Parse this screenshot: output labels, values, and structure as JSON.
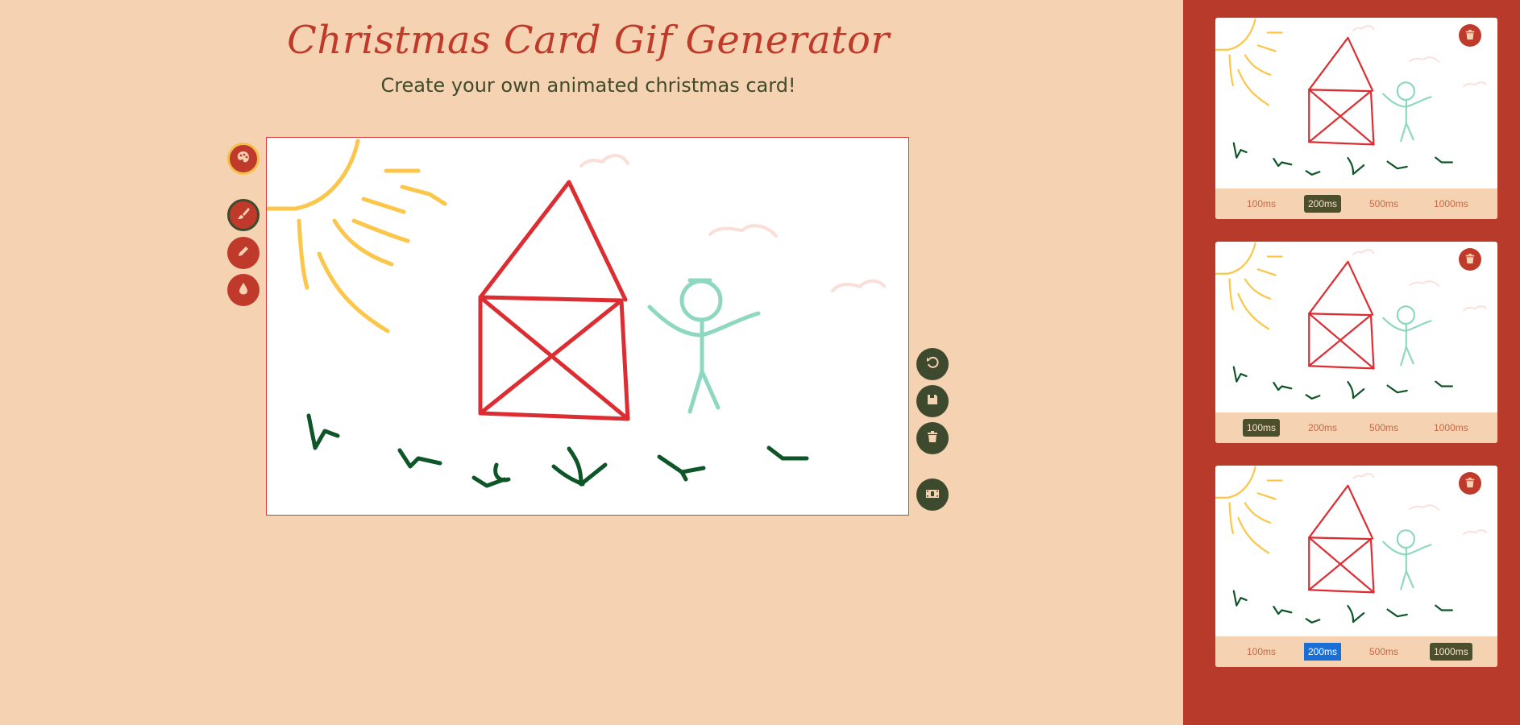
{
  "header": {
    "title": "Christmas Card Gif Generator",
    "subtitle": "Create your own animated christmas card!"
  },
  "tools": [
    {
      "name": "palette-button",
      "icon": "palette-icon"
    },
    {
      "name": "brush-tool-button",
      "icon": "brush-icon",
      "active": true
    },
    {
      "name": "pencil-tool-button",
      "icon": "pencil-icon"
    },
    {
      "name": "drop-tool-button",
      "icon": "drop-icon"
    }
  ],
  "actions": [
    {
      "name": "undo-button",
      "icon": "undo-icon"
    },
    {
      "name": "save-frame-button",
      "icon": "save-icon"
    },
    {
      "name": "clear-button",
      "icon": "trash-icon"
    },
    {
      "name": "generate-gif-button",
      "icon": "film-icon"
    }
  ],
  "colors": {
    "background": "#f5d2b1",
    "accent": "#c03a2b",
    "dark": "#3e4a2e",
    "sidebar": "#b83a2a"
  },
  "frames": [
    {
      "speeds": [
        "100ms",
        "200ms",
        "500ms",
        "1000ms"
      ],
      "selected": "200ms",
      "highlighted": ""
    },
    {
      "speeds": [
        "100ms",
        "200ms",
        "500ms",
        "1000ms"
      ],
      "selected": "100ms",
      "highlighted": ""
    },
    {
      "speeds": [
        "100ms",
        "200ms",
        "500ms",
        "1000ms"
      ],
      "selected": "1000ms",
      "highlighted": "200ms"
    }
  ]
}
